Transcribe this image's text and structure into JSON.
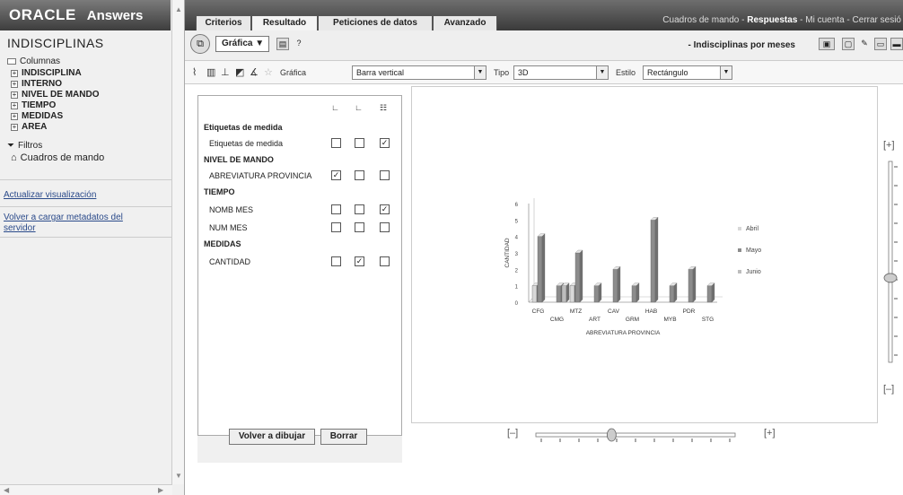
{
  "sidebar": {
    "brand_oracle": "ORACLE",
    "brand_answers": "Answers",
    "title": "INDISCIPLINAS",
    "columns_label": "Columnas",
    "columns": [
      "INDISCIPLINA",
      "INTERNO",
      "NIVEL DE MANDO",
      "TIEMPO",
      "MEDIDAS",
      "AREA"
    ],
    "filters_label": "Filtros",
    "dashboards_label": "Cuadros de mando",
    "link_refresh": "Actualizar visualización",
    "link_reload": "Volver a cargar metadatos del servidor"
  },
  "tabs": [
    "Criterios",
    "Resultado",
    "Peticiones de datos",
    "Avanzado"
  ],
  "topnav": {
    "dashboards": "Cuadros de mando",
    "sep1": " - ",
    "answers": "Respuestas",
    "sep2": " - ",
    "account": "Mi cuenta",
    "sep3": " - ",
    "logout": "Cerrar sesió"
  },
  "toolbar": {
    "view_button": "Gráfica ▼",
    "report_name": "- Indisciplinas por meses"
  },
  "chart_controls": {
    "grafica_label": "Gráfica",
    "grafica_value": "Barra vertical",
    "tipo_label": "Tipo",
    "tipo_value": "3D",
    "estilo_label": "Estilo",
    "estilo_value": "Rectángulo"
  },
  "properties": {
    "rows": [
      {
        "label": "Etiquetas de medida",
        "header": true
      },
      {
        "label": "Etiquetas de medida",
        "checks": [
          false,
          false,
          true
        ]
      },
      {
        "label": "NIVEL DE MANDO",
        "header": true
      },
      {
        "label": "ABREVIATURA PROVINCIA",
        "checks": [
          true,
          false,
          false
        ]
      },
      {
        "label": "TIEMPO",
        "header": true
      },
      {
        "label": "NOMB MES",
        "checks": [
          false,
          false,
          true
        ]
      },
      {
        "label": "NUM MES",
        "checks": [
          false,
          false,
          false
        ]
      },
      {
        "label": "MEDIDAS",
        "header": true
      },
      {
        "label": "CANTIDAD",
        "checks": [
          false,
          true,
          false
        ]
      }
    ],
    "redraw_button": "Volver a dibujar",
    "clear_button": "Borrar"
  },
  "sliders": {
    "vertical_plus": "[+]",
    "vertical_minus": "[–]",
    "horizontal_minus": "[–]",
    "horizontal_plus": "[+]",
    "vertical_position": 0.58,
    "horizontal_position": 0.38
  },
  "colors": {
    "Abril": "#d8d8d8",
    "Mayo": "#8c8c8c",
    "Junio": "#bdbdbd"
  },
  "chart_data": {
    "type": "bar",
    "title": "",
    "xlabel": "ABREVIATURA PROVINCIA",
    "ylabel": "CANTIDAD",
    "ylim": [
      0,
      6
    ],
    "yticks": [
      0,
      1,
      2,
      3,
      4,
      5,
      6
    ],
    "categories": [
      "CFG",
      "CMG",
      "MTZ",
      "ART",
      "CAV",
      "GRM",
      "HAB",
      "MYB",
      "PDR",
      "STG"
    ],
    "series": [
      {
        "name": "Abril",
        "values": [
          1,
          0,
          1,
          0,
          0,
          0,
          0,
          0,
          0,
          0
        ]
      },
      {
        "name": "Mayo",
        "values": [
          4,
          1,
          3,
          1,
          2,
          1,
          5,
          1,
          2,
          1
        ]
      },
      {
        "name": "Junio",
        "values": [
          0,
          1,
          0,
          0,
          0,
          0,
          0,
          0,
          0,
          0
        ]
      }
    ],
    "legend": "right",
    "grid": false
  }
}
